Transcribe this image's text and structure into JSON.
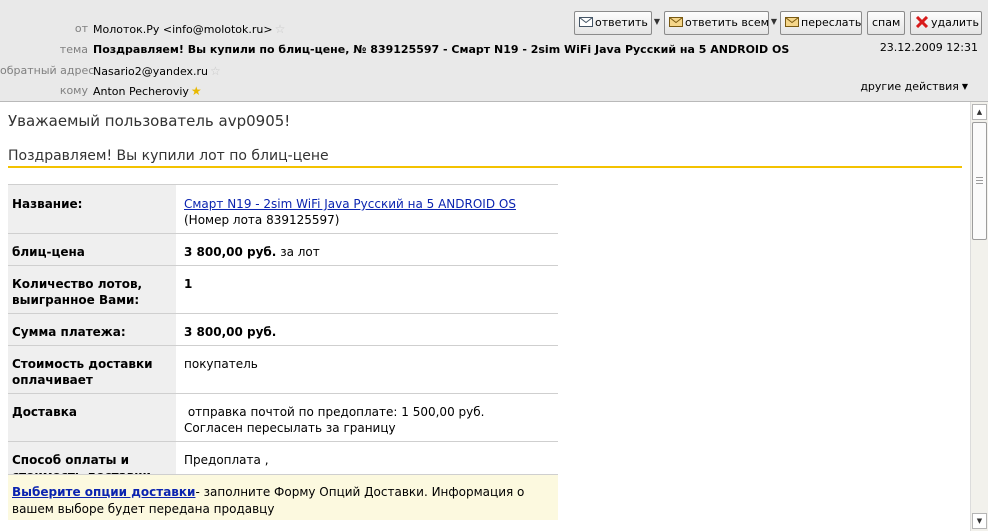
{
  "header": {
    "from_label": "от",
    "from_value": "Молоток.Ру <info@molotok.ru>",
    "subject_label": "тема",
    "subject_value": "Поздравляем! Вы купили по блиц-цене, № 839125597 - Смарт N19 - 2sim WiFi Java Русский на 5 ANDROID OS",
    "reply_to_label": "обратный адрес",
    "reply_to_value": "Nasario2@yandex.ru",
    "to_label": "кому",
    "to_value": "Anton Pecheroviy",
    "date": "23.12.2009 12:31",
    "other_actions": "другие действия"
  },
  "toolbar": {
    "reply_label": "ответить",
    "reply_all_label": "ответить всем",
    "forward_label": "переслать",
    "spam_label": "спам",
    "delete_label": "удалить"
  },
  "message": {
    "greeting": "Уважаемый пользователь avp0905!",
    "congrats": "Поздравляем! Вы купили лот по блиц-цене",
    "rows": [
      {
        "label": "Название:",
        "link": "Смарт N19 - 2sim WiFi Java Русский на 5 ANDROID OS",
        "extra": "(Номер лота 839125597)"
      },
      {
        "label": "блиц-цена",
        "value_bold": "3 800,00 руб.",
        "value_rest": " за лот"
      },
      {
        "label": "Количество лотов, выигранное Вами:",
        "value_bold": "1"
      },
      {
        "label": "Сумма платежа:",
        "value_bold": "3 800,00 руб."
      },
      {
        "label": "Стоимость доставки оплачивает",
        "value": "покупатель"
      },
      {
        "label": "Доставка",
        "line1": " отправка почтой по предоплате: 1 500,00 руб.",
        "line2": "Согласен пересылать за границу"
      },
      {
        "label": "Способ оплаты и стоимость доставки",
        "value": "Предоплата ,"
      }
    ],
    "notice_link": "Выберите опции доставки",
    "notice_text": "- заполните Форму Опций Доставки. Информация о вашем выборе будет передана продавцу"
  },
  "colors": {
    "header_bg": "#e9e9e9",
    "accent_line": "#f3c200",
    "link": "#0b24b0",
    "notice_bg": "#fcf9df"
  },
  "icons": [
    "reply-icon",
    "reply-all-icon",
    "forward-icon",
    "delete-icon",
    "star-icon"
  ]
}
